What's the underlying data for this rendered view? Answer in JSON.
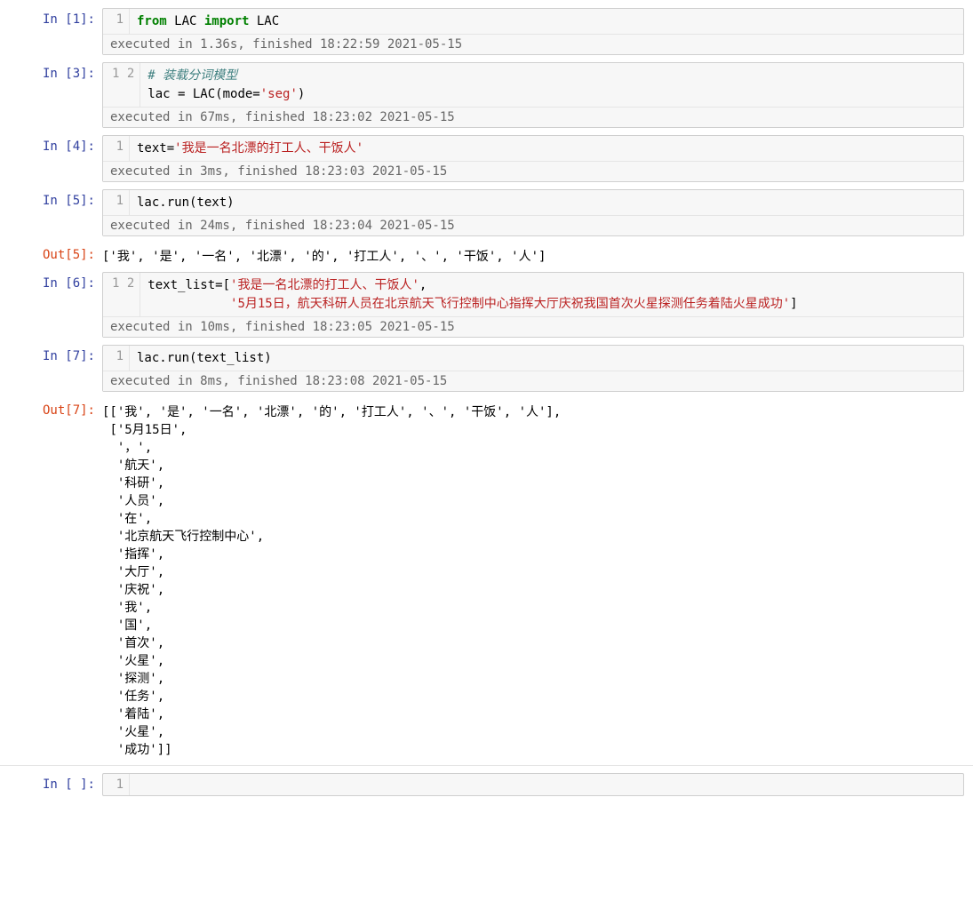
{
  "cells": {
    "c1": {
      "prompt": "In [1]:",
      "gutter": "1",
      "code_html": "<span class='kw'>from</span> LAC <span class='kw'>import</span> LAC",
      "timing": "executed in 1.36s, finished 18:22:59 2021-05-15"
    },
    "c3": {
      "prompt": "In [3]:",
      "gutter": "1\n2",
      "code_html": "<span class='cm'># 装载分词模型</span>\nlac = LAC(mode=<span class='str'>'seg'</span>)",
      "timing": "executed in 67ms, finished 18:23:02 2021-05-15"
    },
    "c4": {
      "prompt": "In [4]:",
      "gutter": "1",
      "code_html": "text=<span class='str'>'我是一名北漂的打工人、干饭人'</span>",
      "timing": "executed in 3ms, finished 18:23:03 2021-05-15"
    },
    "c5": {
      "prompt": "In [5]:",
      "gutter": "1",
      "code_html": "lac.run(text)",
      "timing": "executed in 24ms, finished 18:23:04 2021-05-15"
    },
    "o5": {
      "prompt": "Out[5]:",
      "text": "['我', '是', '一名', '北漂', '的', '打工人', '、', '干饭', '人']"
    },
    "c6": {
      "prompt": "In [6]:",
      "gutter": "1\n2",
      "code_html": "text_list=[<span class='str'>'我是一名北漂的打工人、干饭人'</span>,\n           <span class='str'>'5月15日，航天科研人员在北京航天飞行控制中心指挥大厅庆祝我国首次火星探测任务着陆火星成功'</span>]",
      "timing": "executed in 10ms, finished 18:23:05 2021-05-15"
    },
    "c7": {
      "prompt": "In [7]:",
      "gutter": "1",
      "code_html": "lac.run(text_list)",
      "timing": "executed in 8ms, finished 18:23:08 2021-05-15"
    },
    "o7": {
      "prompt": "Out[7]:",
      "text": "[['我', '是', '一名', '北漂', '的', '打工人', '、', '干饭', '人'],\n ['5月15日',\n  '，',\n  '航天',\n  '科研',\n  '人员',\n  '在',\n  '北京航天飞行控制中心',\n  '指挥',\n  '大厅',\n  '庆祝',\n  '我',\n  '国',\n  '首次',\n  '火星',\n  '探测',\n  '任务',\n  '着陆',\n  '火星',\n  '成功']]"
    },
    "cE": {
      "prompt": "In [ ]:",
      "gutter": "1",
      "code_html": "",
      "timing": ""
    }
  }
}
